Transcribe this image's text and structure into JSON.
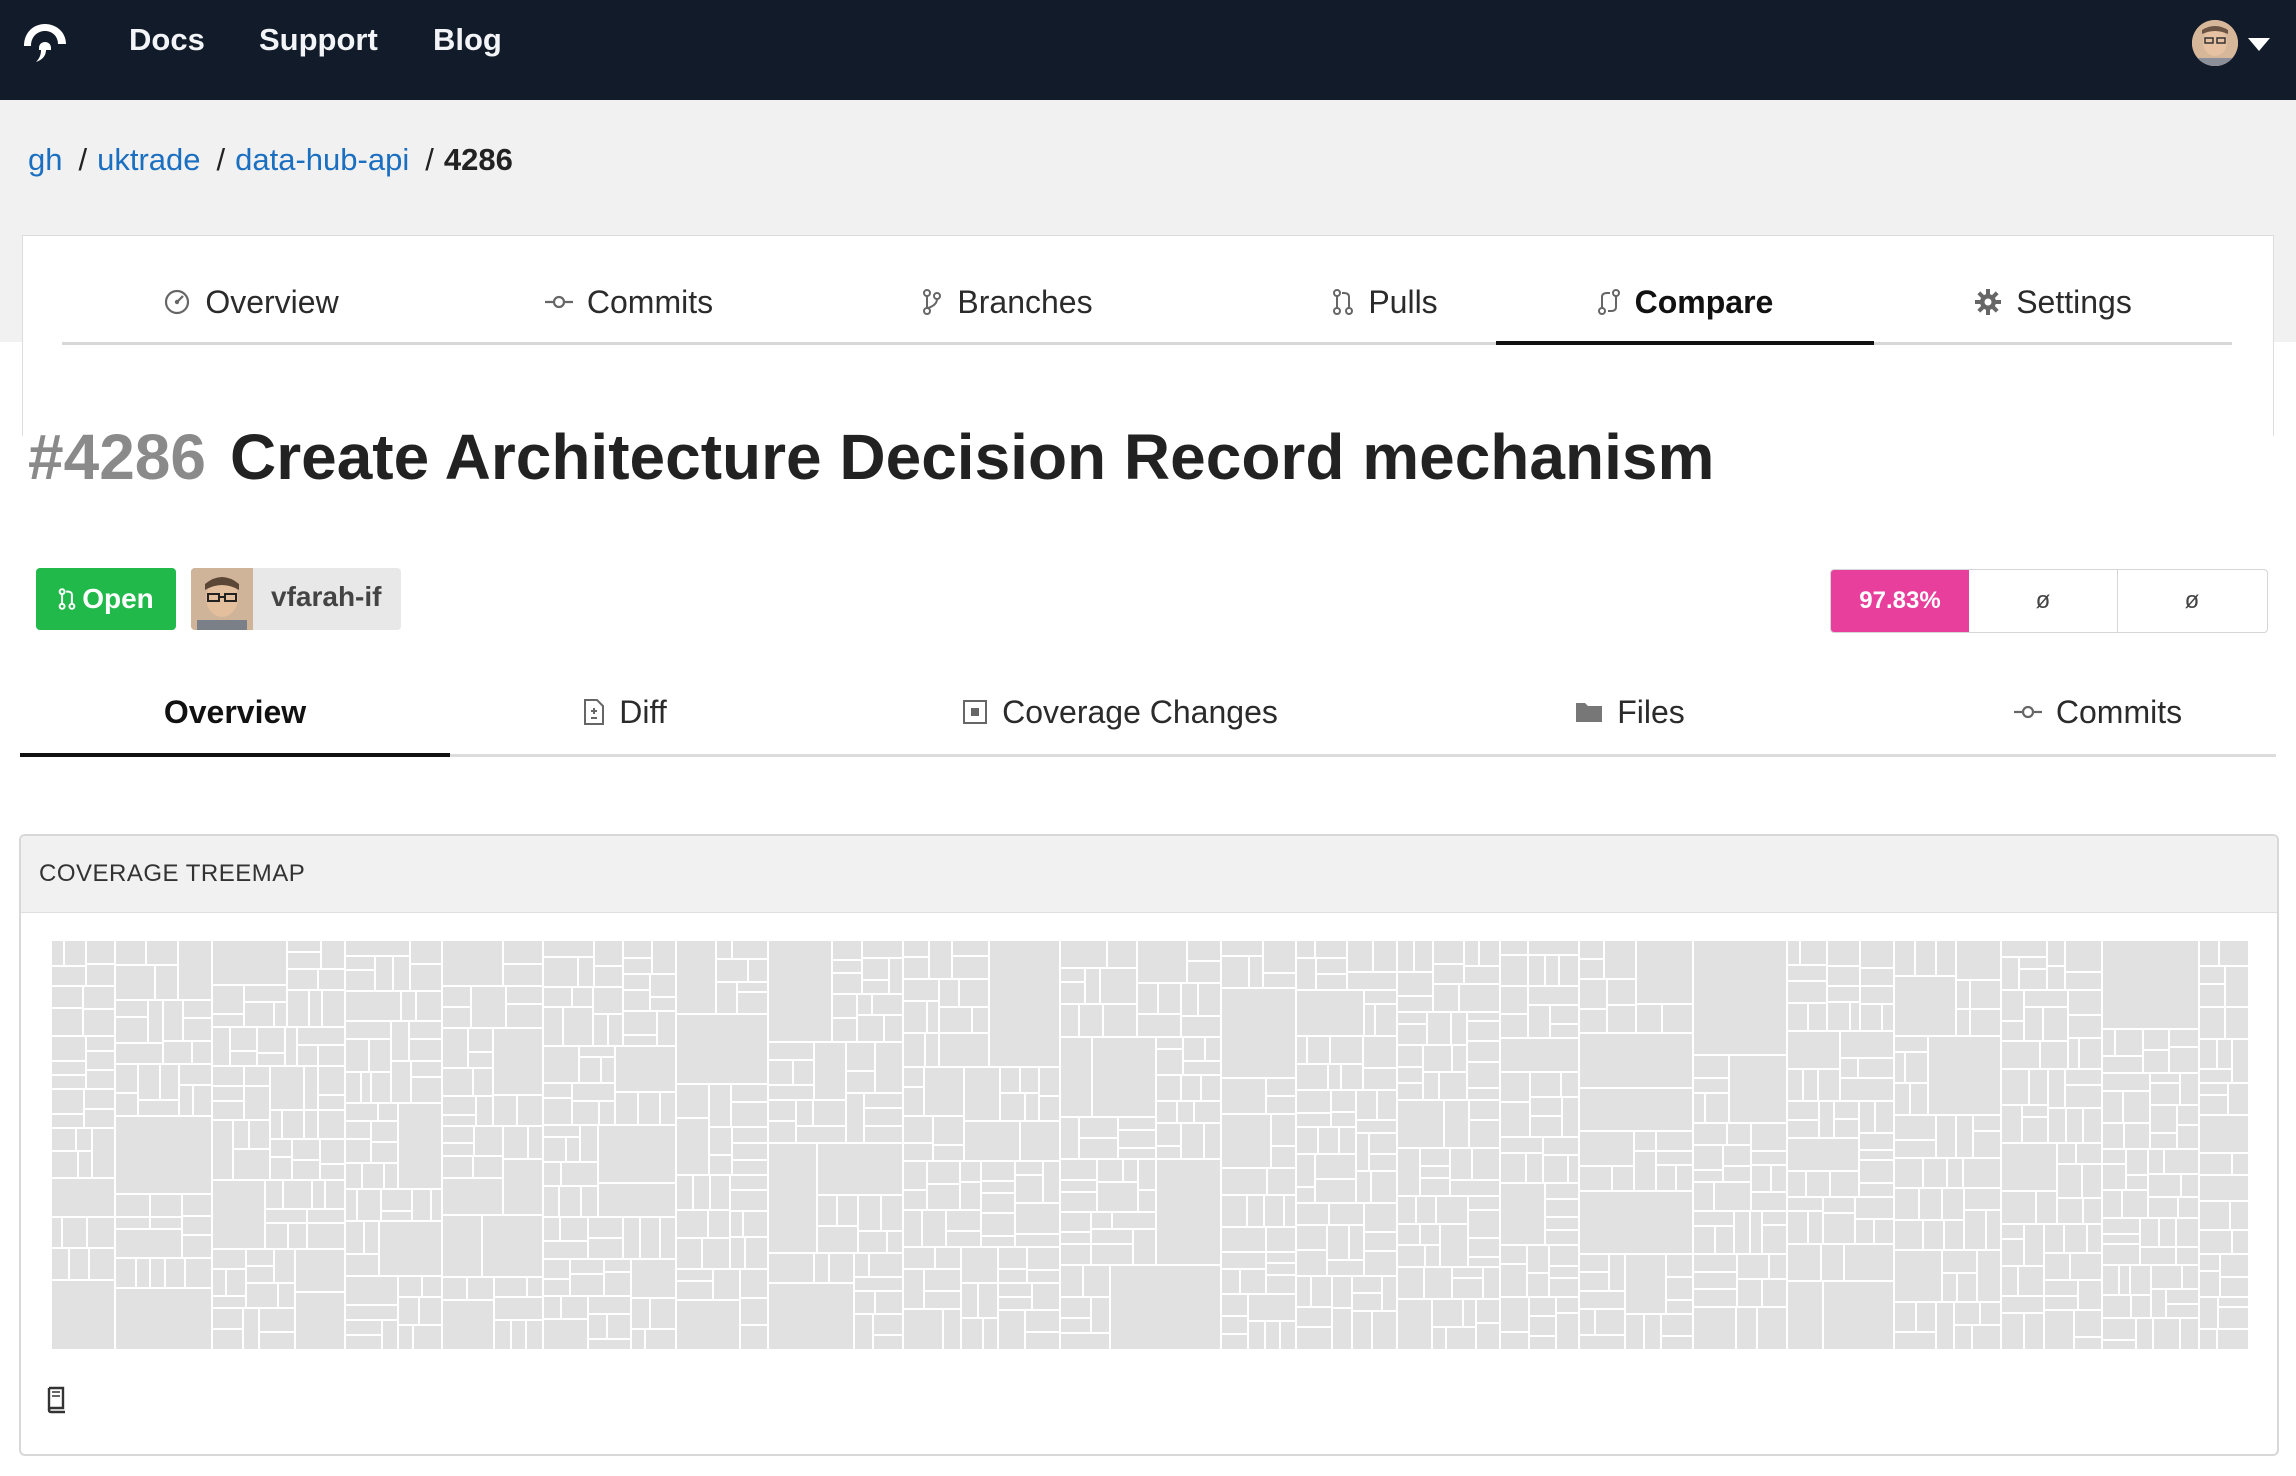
{
  "nav": {
    "items": [
      {
        "label": "Docs"
      },
      {
        "label": "Support"
      },
      {
        "label": "Blog"
      }
    ]
  },
  "breadcrumb": {
    "service": "gh",
    "org": "uktrade",
    "repo": "data-hub-api",
    "current": "4286",
    "separator": "/"
  },
  "repo_tabs": [
    {
      "label": "Overview",
      "icon": "gauge-icon"
    },
    {
      "label": "Commits",
      "icon": "commit-icon"
    },
    {
      "label": "Branches",
      "icon": "branch-icon"
    },
    {
      "label": "Pulls",
      "icon": "pull-request-icon"
    },
    {
      "label": "Compare",
      "icon": "compare-icon",
      "active": true
    },
    {
      "label": "Settings",
      "icon": "gear-icon"
    }
  ],
  "pull": {
    "number": "#4286",
    "title": "Create Architecture Decision Record mechanism",
    "state": "Open",
    "author": "vfarah-if"
  },
  "coverage": {
    "head": "97.83%",
    "patch": "ø",
    "change": "ø"
  },
  "pull_tabs": [
    {
      "label": "Overview",
      "active": true
    },
    {
      "label": "Diff",
      "icon": "diff-file-icon"
    },
    {
      "label": "Coverage Changes",
      "icon": "coverage-icon"
    },
    {
      "label": "Files",
      "icon": "folder-icon"
    },
    {
      "label": "Commits",
      "icon": "commit-icon"
    }
  ],
  "treemap": {
    "title": "COVERAGE TREEMAP"
  },
  "colors": {
    "navbar": "#121b29",
    "link": "#1a6fc1",
    "open_badge": "#21b94a",
    "coverage_badge": "#e83e9c",
    "treemap_cell": "#e1e1e1"
  }
}
